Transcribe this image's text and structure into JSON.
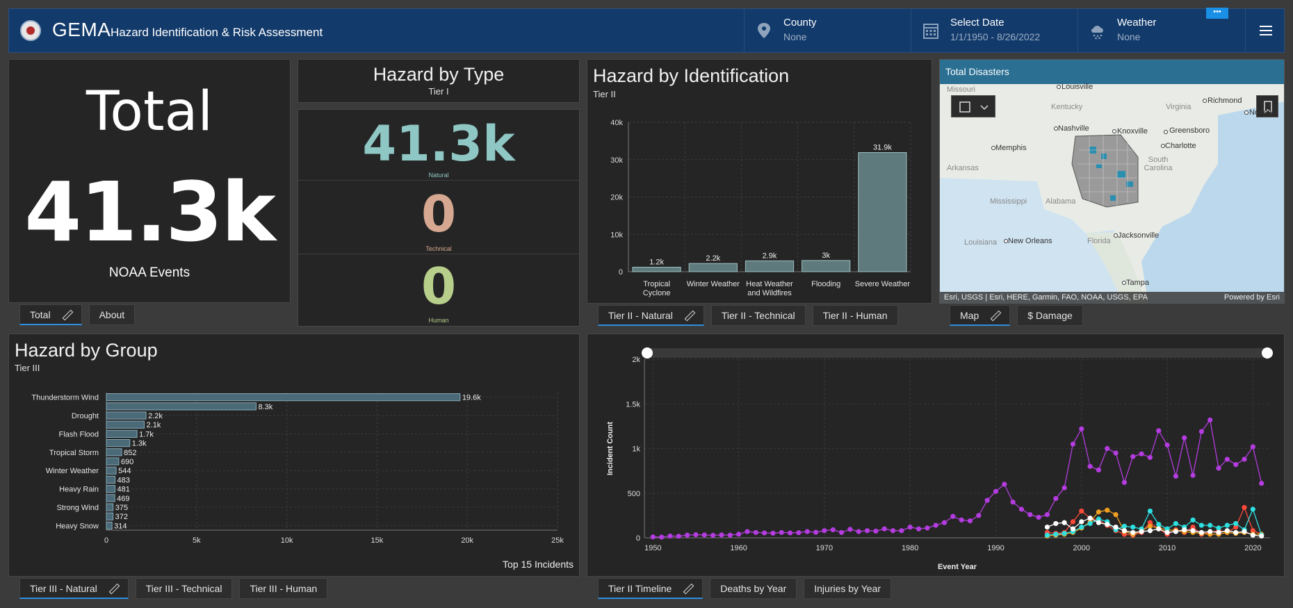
{
  "header": {
    "app_name": "GEMA",
    "app_subtitle": "Hazard Identification & Risk Assessment",
    "county_label": "County",
    "county_value": "None",
    "date_label": "Select Date",
    "date_value": "1/1/1950 - 8/26/2022",
    "weather_label": "Weather",
    "weather_value": "None",
    "more_label": "•••"
  },
  "total_panel": {
    "title": "Total",
    "value": "41.3k",
    "caption": "NOAA Events",
    "tabs": [
      "Total",
      "About"
    ]
  },
  "type_panel": {
    "title": "Hazard by Type",
    "subtitle": "Tier I",
    "natural_value": "41.3k",
    "natural_label": "Natural",
    "technical_value": "0",
    "technical_label": "Technical",
    "human_value": "0",
    "human_label": "Human"
  },
  "identification_panel": {
    "title": "Hazard by Identification",
    "subtitle": "Tier II",
    "tabs": [
      "Tier II - Natural",
      "Tier II - Technical",
      "Tier II - Human"
    ]
  },
  "map_panel": {
    "title": "Total Disasters",
    "attribution": "Esri, USGS | Esri, HERE, Garmin, FAO, NOAA, USGS, EPA",
    "powered": "Powered by Esri",
    "tabs": [
      "Map",
      "$ Damage"
    ],
    "places": [
      "Missouri",
      "Louisville",
      "Kentucky",
      "Virginia",
      "Richmond",
      "Norfolk",
      "Nashville",
      "Knoxville",
      "Greensboro",
      "Memphis",
      "Charlotte",
      "Arkansas",
      "South Carolina",
      "Mississippi",
      "Alabama",
      "Louisiana",
      "New Orleans",
      "Florida",
      "Jacksonville",
      "Tampa"
    ]
  },
  "group_panel": {
    "title": "Hazard by Group",
    "subtitle": "Tier III",
    "footer": "Top 15 Incidents",
    "tabs": [
      "Tier III - Natural",
      "Tier III - Technical",
      "Tier III - Human"
    ]
  },
  "timeline_panel": {
    "tabs": [
      "Tier II Timeline",
      "Deaths by Year",
      "Injuries by Year"
    ]
  },
  "colors": {
    "accent": "#2d8fe0",
    "natural": "#8fc7c4",
    "technical": "#d7a891",
    "human": "#b7cf8b",
    "bar": "#5f7a7d",
    "purple": "#b43ce0"
  },
  "chart_data": [
    {
      "type": "bar",
      "categories": [
        "Tropical Cyclone",
        "Winter Weather",
        "Heat Weather and Wildfires",
        "Flooding",
        "Severe Weather"
      ],
      "values": [
        1200,
        2200,
        2900,
        3000,
        31900
      ],
      "value_labels": [
        "1.2k",
        "2.2k",
        "2.9k",
        "3k",
        "31.9k"
      ],
      "ylim": [
        0,
        40000
      ],
      "yticks": [
        "0",
        "10k",
        "20k",
        "30k",
        "40k"
      ],
      "grid": true
    },
    {
      "type": "bar",
      "orientation": "horizontal",
      "categories": [
        "Thunderstorm Wind",
        "",
        "Drought",
        "",
        "Flash Flood",
        "",
        "Tropical Storm",
        "",
        "Winter Weather",
        "",
        "Heavy Rain",
        "",
        "Strong Wind",
        "",
        "Heavy Snow"
      ],
      "values": [
        19600,
        8300,
        2200,
        2100,
        1700,
        1300,
        852,
        690,
        544,
        483,
        481,
        469,
        375,
        372,
        314
      ],
      "value_labels": [
        "19.6k",
        "8.3k",
        "2.2k",
        "2.1k",
        "1.7k",
        "1.3k",
        "852",
        "690",
        "544",
        "483",
        "481",
        "469",
        "375",
        "372",
        "314"
      ],
      "xlim": [
        0,
        25000
      ],
      "xticks": [
        "0",
        "5k",
        "10k",
        "15k",
        "20k",
        "25k"
      ],
      "grid": true
    },
    {
      "type": "line",
      "xlabel": "Event Year",
      "ylabel": "Incident Count",
      "xlim": [
        1949,
        2022
      ],
      "ylim": [
        0,
        2000
      ],
      "xticks": [
        "1950",
        "1960",
        "1970",
        "1980",
        "1990",
        "2000",
        "2010",
        "2020"
      ],
      "yticks": [
        "0",
        "500",
        "1k",
        "1.5k",
        "2k"
      ],
      "grid": true,
      "series": [
        {
          "color": "#b43ce0",
          "x": [
            1950,
            1951,
            1952,
            1953,
            1954,
            1955,
            1956,
            1957,
            1958,
            1959,
            1960,
            1961,
            1962,
            1963,
            1964,
            1965,
            1966,
            1967,
            1968,
            1969,
            1970,
            1971,
            1972,
            1973,
            1974,
            1975,
            1976,
            1977,
            1978,
            1979,
            1980,
            1981,
            1982,
            1983,
            1984,
            1985,
            1986,
            1987,
            1988,
            1989,
            1990,
            1991,
            1992,
            1993,
            1994,
            1995,
            1996,
            1997,
            1998,
            1999,
            2000,
            2001,
            2002,
            2003,
            2004,
            2005,
            2006,
            2007,
            2008,
            2009,
            2010,
            2011,
            2012,
            2013,
            2014,
            2015,
            2016,
            2017,
            2018,
            2019,
            2020,
            2021
          ],
          "y": [
            10,
            8,
            20,
            18,
            30,
            35,
            32,
            28,
            32,
            30,
            40,
            70,
            60,
            55,
            52,
            60,
            55,
            58,
            70,
            62,
            80,
            90,
            60,
            95,
            70,
            80,
            75,
            100,
            80,
            80,
            120,
            100,
            110,
            140,
            170,
            240,
            200,
            190,
            250,
            420,
            520,
            600,
            400,
            320,
            260,
            230,
            260,
            440,
            560,
            1050,
            1220,
            800,
            760,
            1000,
            950,
            620,
            910,
            940,
            900,
            1200,
            1040,
            690,
            1120,
            700,
            1190,
            1320,
            780,
            880,
            820,
            880,
            1020,
            610
          ]
        },
        {
          "color": "#ff4a3a",
          "x": [
            1996,
            1997,
            1998,
            1999,
            2000,
            2001,
            2002,
            2003,
            2004,
            2005,
            2006,
            2007,
            2008,
            2009,
            2010,
            2011,
            2012,
            2013,
            2014,
            2015,
            2016,
            2017,
            2018,
            2019,
            2020,
            2021
          ],
          "y": [
            60,
            50,
            60,
            180,
            300,
            220,
            200,
            140,
            80,
            40,
            30,
            60,
            170,
            100,
            40,
            90,
            60,
            120,
            40,
            60,
            80,
            60,
            120,
            340,
            80,
            40
          ]
        },
        {
          "color": "#f0a020",
          "x": [
            1996,
            1997,
            1998,
            1999,
            2000,
            2001,
            2002,
            2003,
            2004,
            2005,
            2006,
            2007,
            2008,
            2009,
            2010,
            2011,
            2012,
            2013,
            2014,
            2015,
            2016,
            2017,
            2018,
            2019,
            2020,
            2021
          ],
          "y": [
            20,
            30,
            40,
            60,
            110,
            180,
            290,
            310,
            260,
            70,
            40,
            80,
            130,
            110,
            90,
            80,
            70,
            60,
            50,
            40,
            40,
            60,
            50,
            60,
            40,
            40
          ]
        },
        {
          "color": "#2ee0e0",
          "x": [
            1996,
            1997,
            1998,
            1999,
            2000,
            2001,
            2002,
            2003,
            2004,
            2005,
            2006,
            2007,
            2008,
            2009,
            2010,
            2011,
            2012,
            2013,
            2014,
            2015,
            2016,
            2017,
            2018,
            2019,
            2020,
            2021
          ],
          "y": [
            30,
            40,
            50,
            70,
            120,
            160,
            210,
            180,
            90,
            130,
            120,
            100,
            300,
            150,
            100,
            160,
            120,
            200,
            140,
            140,
            110,
            140,
            160,
            90,
            320,
            30
          ]
        },
        {
          "color": "#ffffff",
          "x": [
            1996,
            1997,
            1998,
            1999,
            2000,
            2001,
            2002,
            2003,
            2004,
            2005,
            2006,
            2007,
            2008,
            2009,
            2010,
            2011,
            2012,
            2013,
            2014,
            2015,
            2016,
            2017,
            2018,
            2019,
            2020,
            2021
          ],
          "y": [
            120,
            160,
            170,
            100,
            180,
            220,
            170,
            150,
            120,
            80,
            60,
            70,
            80,
            100,
            60,
            70,
            90,
            80,
            60,
            70,
            60,
            80,
            60,
            70,
            30,
            20
          ]
        }
      ]
    }
  ]
}
